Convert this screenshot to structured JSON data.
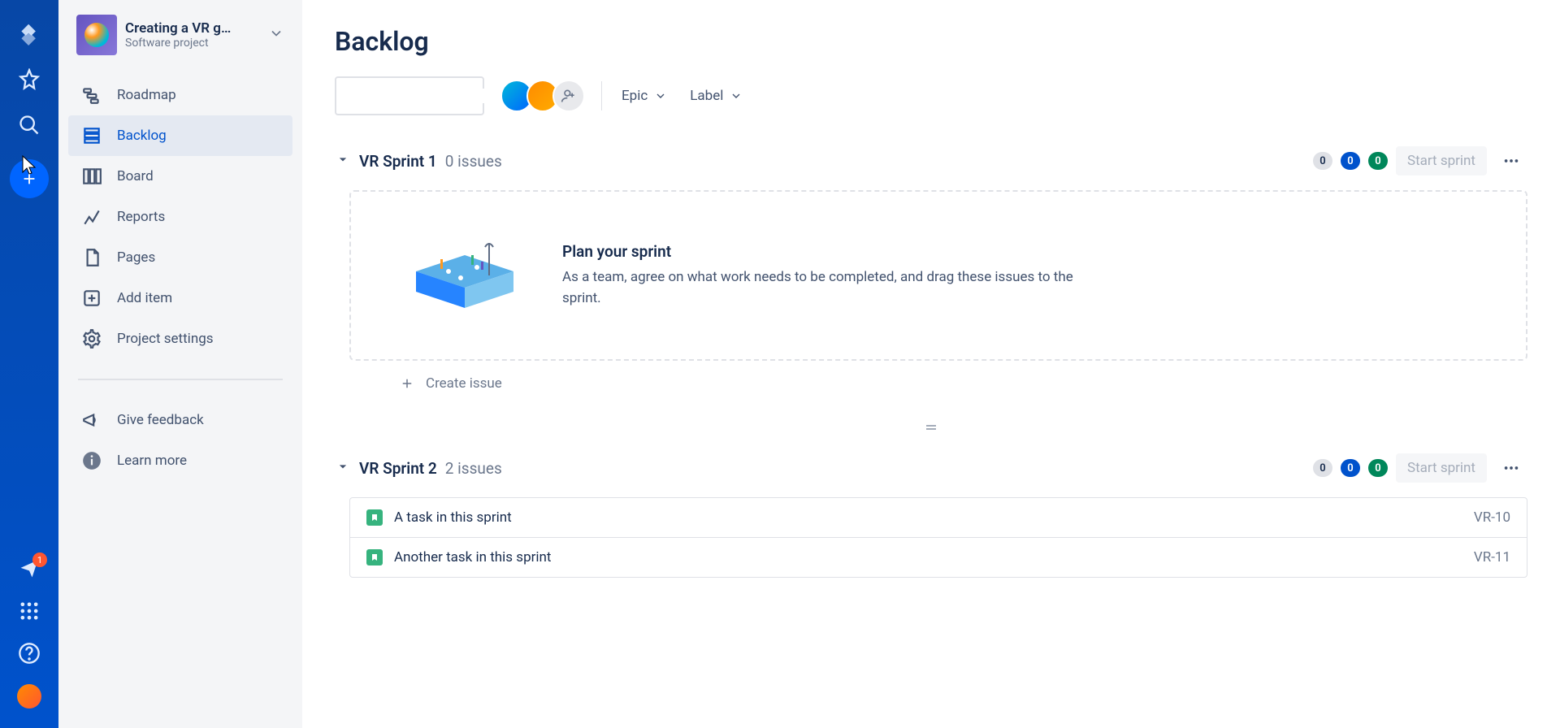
{
  "rail": {
    "notification_count": "1"
  },
  "project": {
    "name": "Creating a VR g…",
    "subtitle": "Software project"
  },
  "nav": {
    "roadmap": "Roadmap",
    "backlog": "Backlog",
    "board": "Board",
    "reports": "Reports",
    "pages": "Pages",
    "add_item": "Add item",
    "project_settings": "Project settings"
  },
  "sidebar_bottom": {
    "give_feedback": "Give feedback",
    "learn_more": "Learn more"
  },
  "page": {
    "title": "Backlog"
  },
  "toolbar": {
    "epic": "Epic",
    "label": "Label"
  },
  "sprints": [
    {
      "name": "VR Sprint 1",
      "count_text": "0 issues",
      "pills": [
        "0",
        "0",
        "0"
      ],
      "start_label": "Start sprint",
      "empty_title": "Plan your sprint",
      "empty_desc": "As a team, agree on what work needs to be completed, and drag these issues to the sprint.",
      "create_issue": "Create issue",
      "issues": []
    },
    {
      "name": "VR Sprint 2",
      "count_text": "2 issues",
      "pills": [
        "0",
        "0",
        "0"
      ],
      "start_label": "Start sprint",
      "issues": [
        {
          "summary": "A task in this sprint",
          "key": "VR-10"
        },
        {
          "summary": "Another task in this sprint",
          "key": "VR-11"
        }
      ]
    }
  ]
}
